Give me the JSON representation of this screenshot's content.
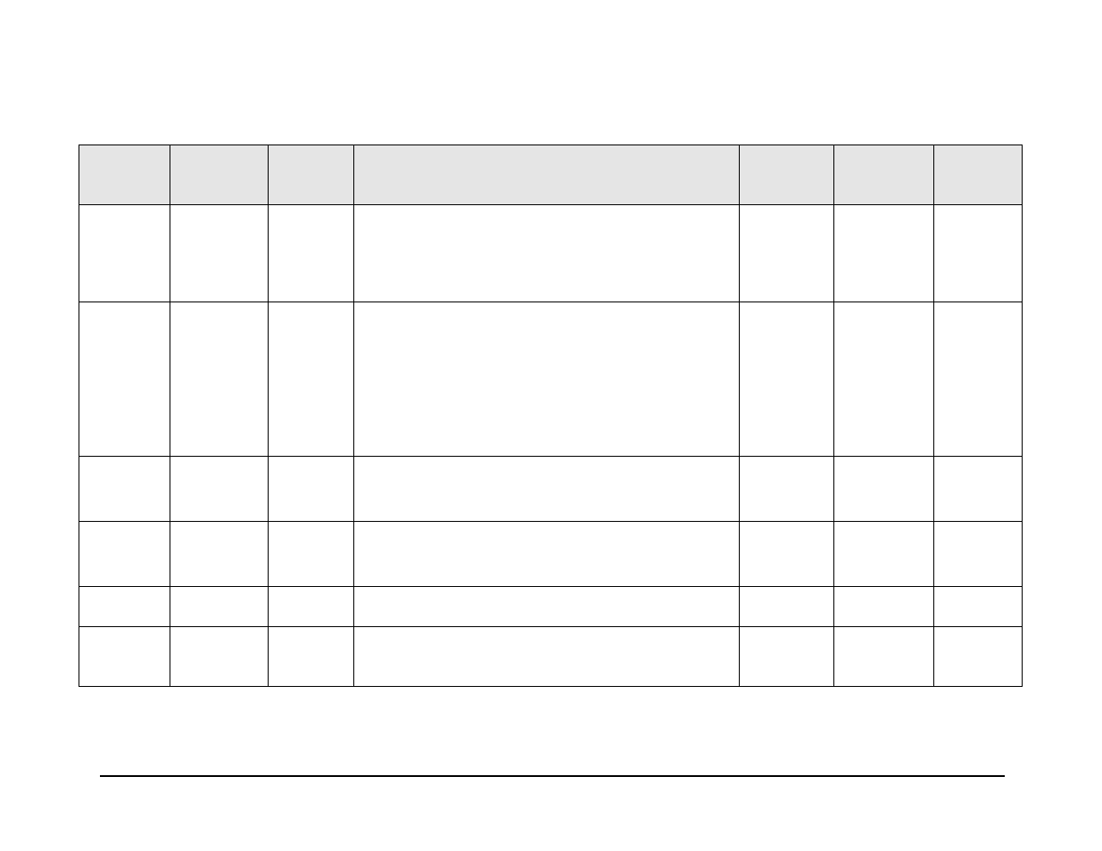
{
  "table": {
    "headers": [
      "",
      "",
      "",
      "",
      "",
      "",
      ""
    ],
    "rows": [
      [
        "",
        "",
        "",
        "",
        "",
        "",
        ""
      ],
      [
        "",
        "",
        "",
        "",
        "",
        "",
        ""
      ],
      [
        "",
        "",
        "",
        "",
        "",
        "",
        ""
      ],
      [
        "",
        "",
        "",
        "",
        "",
        "",
        ""
      ],
      [
        "",
        "",
        "",
        "",
        "",
        "",
        ""
      ],
      [
        "",
        "",
        "",
        "",
        "",
        "",
        ""
      ]
    ]
  }
}
